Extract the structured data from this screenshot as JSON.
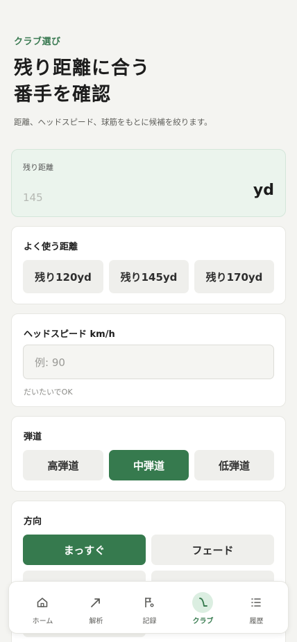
{
  "header": {
    "eyebrow": "クラブ選び",
    "title_line1": "残り距離に合う",
    "title_line2": "番手を確認",
    "subtitle": "距離、ヘッドスピード、球筋をもとに候補を絞ります。"
  },
  "distance": {
    "label": "残り距離",
    "placeholder": "145",
    "unit": "yd"
  },
  "frequent": {
    "label": "よく使う距離",
    "options": [
      "残り120yd",
      "残り145yd",
      "残り170yd"
    ]
  },
  "head_speed": {
    "label": "ヘッドスピード km/h",
    "placeholder": "例: 90",
    "hint": "だいたいでOK"
  },
  "trajectory": {
    "label": "弾道",
    "options": [
      "高弾道",
      "中弾道",
      "低弾道"
    ],
    "selected": "中弾道"
  },
  "direction": {
    "label": "方向",
    "options": [
      "まっすぐ",
      "フェード"
    ],
    "selected": "まっすぐ"
  },
  "tabbar": {
    "items": [
      {
        "label": "ホーム",
        "icon": "home-icon"
      },
      {
        "label": "解析",
        "icon": "trend-arrow-icon"
      },
      {
        "label": "記録",
        "icon": "flag-icon"
      },
      {
        "label": "クラブ",
        "icon": "golf-club-icon"
      },
      {
        "label": "履歴",
        "icon": "list-icon"
      }
    ],
    "active": "クラブ"
  },
  "colors": {
    "accent": "#367a4e",
    "accent_light": "#dbeee1",
    "background": "#f4f4f1",
    "distance_card_bg": "#ebf4ed"
  }
}
